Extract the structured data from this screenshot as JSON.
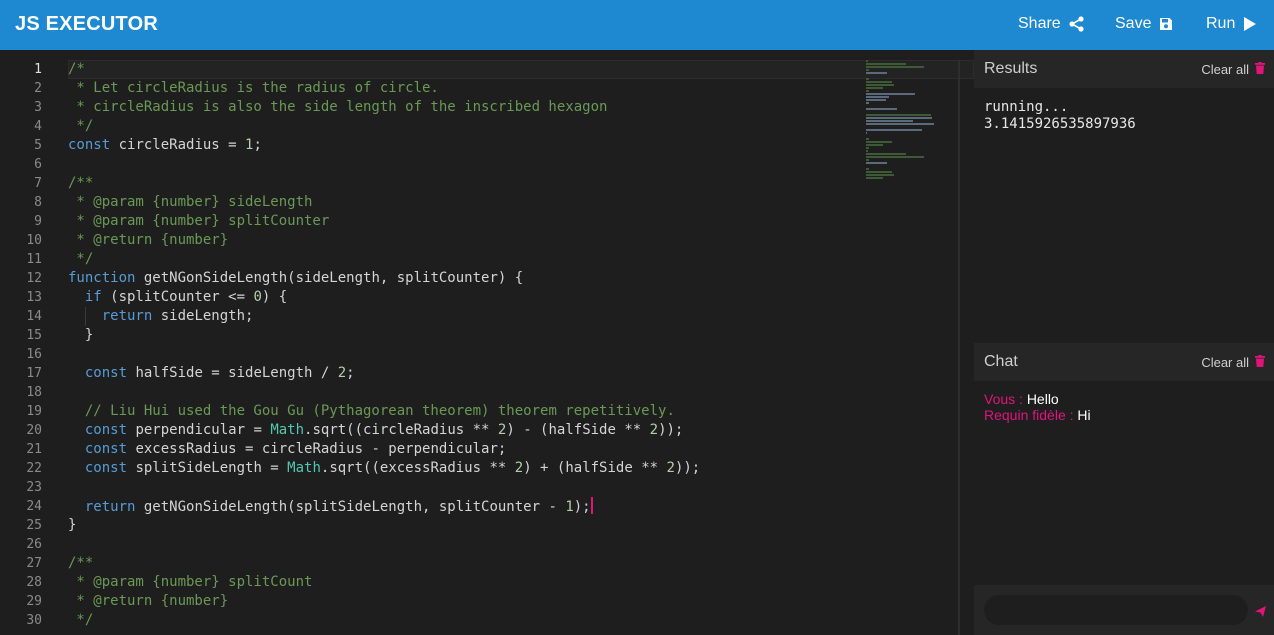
{
  "header": {
    "title": "JS EXECUTOR",
    "share_label": "Share",
    "save_label": "Save",
    "run_label": "Run"
  },
  "editor": {
    "line_numbers": [
      "1",
      "2",
      "3",
      "4",
      "5",
      "6",
      "7",
      "8",
      "9",
      "10",
      "11",
      "12",
      "13",
      "14",
      "15",
      "16",
      "17",
      "18",
      "19",
      "20",
      "21",
      "22",
      "23",
      "24",
      "25",
      "26",
      "27",
      "28",
      "29",
      "30"
    ],
    "active_line": 1,
    "lines": [
      "/*",
      " * Let circleRadius is the radius of circle.",
      " * circleRadius is also the side length of the inscribed hexagon",
      " */",
      "const circleRadius = 1;",
      "",
      "/**",
      " * @param {number} sideLength",
      " * @param {number} splitCounter",
      " * @return {number}",
      " */",
      "function getNGonSideLength(sideLength, splitCounter) {",
      "  if (splitCounter <= 0) {",
      "    return sideLength;",
      "  }",
      "",
      "  const halfSide = sideLength / 2;",
      "",
      "  // Liu Hui used the Gou Gu (Pythagorean theorem) theorem repetitively.",
      "  const perpendicular = Math.sqrt((circleRadius ** 2) - (halfSide ** 2));",
      "  const excessRadius = circleRadius - perpendicular;",
      "  const splitSideLength = Math.sqrt((excessRadius ** 2) + (halfSide ** 2));",
      "",
      "  return getNGonSideLength(splitSideLength, splitCounter - 1);",
      "}",
      "",
      "/**",
      " * @param {number} splitCount",
      " * @return {number}",
      " */"
    ]
  },
  "results": {
    "title": "Results",
    "clear_label": "Clear all",
    "output": [
      "running...",
      "3.1415926535897936"
    ]
  },
  "chat": {
    "title": "Chat",
    "clear_label": "Clear all",
    "messages": [
      {
        "author": "Vous : ",
        "text": "Hello"
      },
      {
        "author": "Requin fidèle : ",
        "text": "Hi"
      }
    ],
    "input_placeholder": "",
    "input_value": ""
  },
  "colors": {
    "accent": "#1e88d0",
    "highlight": "#e0157a",
    "keyword": "#569cd6",
    "comment": "#6a9955",
    "number": "#b5cea8",
    "builtin": "#4ec9b0"
  },
  "icons": {
    "share": "share-icon",
    "save": "save-icon",
    "run": "play-icon",
    "clear": "trash-icon",
    "send": "send-icon"
  }
}
